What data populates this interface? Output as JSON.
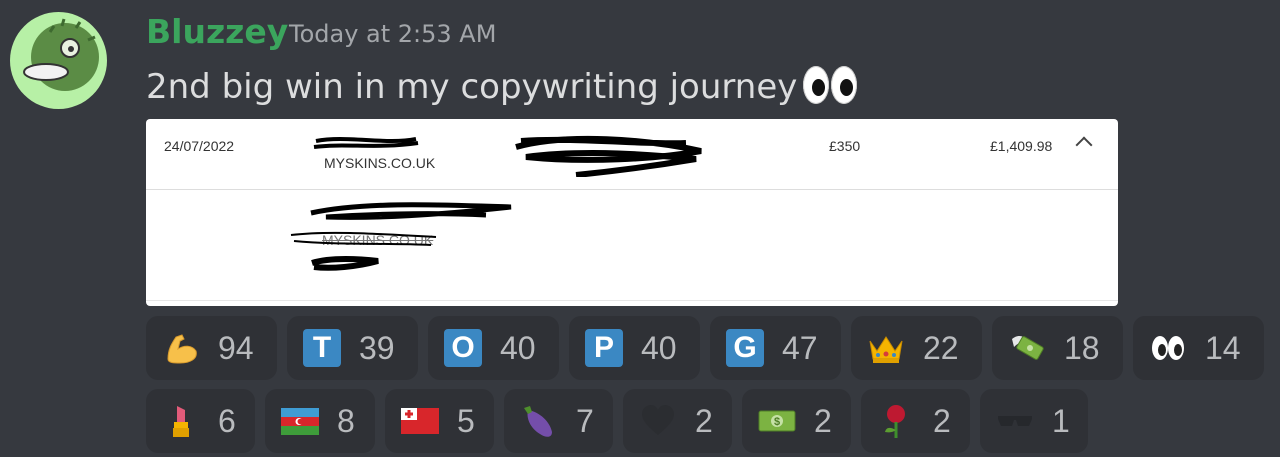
{
  "message": {
    "username": "Bluzzey",
    "timestamp": "Today at 2:53 AM",
    "text": "2nd big win in my copywriting journey",
    "text_emoji": "eyes-icon"
  },
  "attachment": {
    "date": "24/07/2022",
    "merchant": "MYSKINS.CO.UK",
    "amount": "£350",
    "balance": "£1,409.98",
    "detail_merchant": "MYSKINS.CO.UK"
  },
  "reactions": [
    {
      "emoji": "flexed-biceps-icon",
      "count": "94"
    },
    {
      "emoji": "letter-t-icon",
      "letter": "T",
      "count": "39"
    },
    {
      "emoji": "letter-o-icon",
      "letter": "O",
      "count": "40"
    },
    {
      "emoji": "letter-p-icon",
      "letter": "P",
      "count": "40"
    },
    {
      "emoji": "letter-g-icon",
      "letter": "G",
      "count": "47"
    },
    {
      "emoji": "crown-icon",
      "count": "22"
    },
    {
      "emoji": "money-with-wings-icon",
      "count": "18"
    },
    {
      "emoji": "eyes-icon",
      "count": "14"
    },
    {
      "emoji": "lipstick-icon",
      "count": "6"
    },
    {
      "emoji": "azerbaijan-flag-icon",
      "count": "8"
    },
    {
      "emoji": "tonga-flag-icon",
      "count": "5"
    },
    {
      "emoji": "eggplant-icon",
      "count": "7"
    },
    {
      "emoji": "black-heart-icon",
      "count": "2"
    },
    {
      "emoji": "dollar-banknote-icon",
      "count": "2"
    },
    {
      "emoji": "rose-icon",
      "count": "2"
    },
    {
      "emoji": "sunglasses-icon",
      "count": "1"
    }
  ],
  "colors": {
    "background": "#36393f",
    "username": "#3ba55d",
    "reaction_bg": "#2f3136",
    "avatar_bg": "#b7f0a6"
  }
}
